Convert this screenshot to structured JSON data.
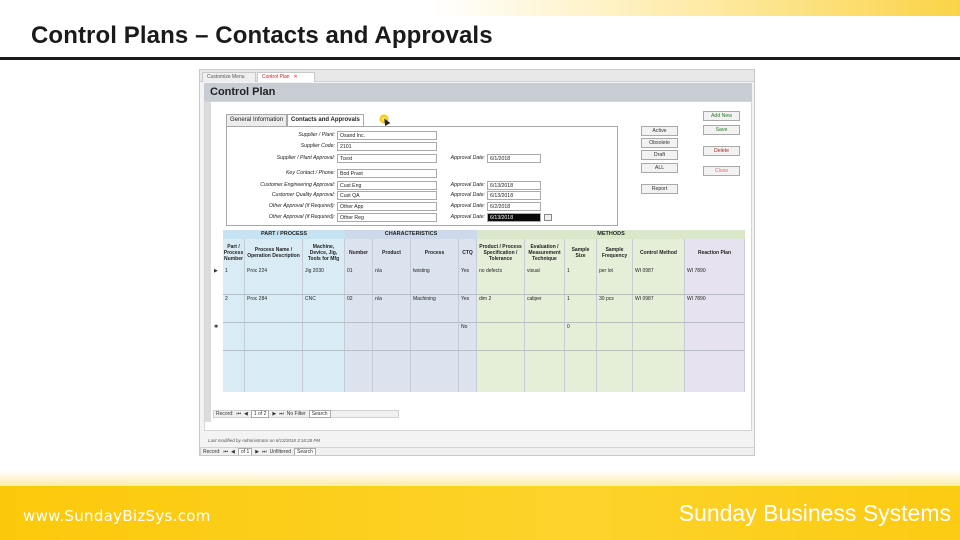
{
  "slide": {
    "title": "Control Plans – Contacts and Approvals",
    "url": "www.SundayBizSys.com",
    "brand": "Sunday Business Systems"
  },
  "app": {
    "doc_tabs": [
      "Customize Menu",
      "Control Plan"
    ],
    "form_title": "Control Plan",
    "form_tabs": [
      "General Information",
      "Contacts and Approvals"
    ],
    "fields": {
      "supplier_plant": {
        "label": "Supplier / Plant:",
        "value": "Osand Inc."
      },
      "supplier_code": {
        "label": "Supplier Code:",
        "value": "2101"
      },
      "supplier_plant_approval": {
        "label": "Supplier / Plant Approval:",
        "value": "Tcest"
      },
      "key_contact_phone": {
        "label": "Key Contact / Phone:",
        "value": "Bod Prast"
      },
      "customer_engineering_approval": {
        "label": "Customer Engineering Approval:",
        "value": "Cust Eng"
      },
      "customer_quality_approval": {
        "label": "Customer Quality Approval:",
        "value": "Cust QA"
      },
      "other_approval_1": {
        "label": "Other Approval (if Required):",
        "value": "Other App"
      },
      "other_approval_2": {
        "label": "Other Approval (if Required):",
        "value": "Other Reg"
      },
      "approval_date_1": {
        "label": "Approval Date:",
        "value": "6/1/2018"
      },
      "approval_date_2": {
        "label": "Approval Date:",
        "value": "6/13/2018"
      },
      "approval_date_3": {
        "label": "Approval Date:",
        "value": "6/13/2018"
      },
      "approval_date_4": {
        "label": "Approval Date:",
        "value": "6/2/2018"
      },
      "approval_date_5": {
        "label": "Approval Date:",
        "value": "6/13/2018"
      }
    },
    "buttons": {
      "add_new": "Add New",
      "save": "Save",
      "active": "Active",
      "obsolete": "Obsolete",
      "draft": "Draft",
      "all": "ALL",
      "delete": "Delete",
      "close": "Close",
      "report": "Report"
    },
    "grid": {
      "groups": [
        "PART / PROCESS",
        "CHARACTERISTICS",
        "METHODS"
      ],
      "columns": [
        "Part / Process Number",
        "Process Name / Operation Description",
        "Machine, Device, Jig, Tools for Mfg",
        "Number",
        "Product",
        "Process",
        "CTQ",
        "Product / Process Specification / Tolerance",
        "Evaluation / Measurement Technique",
        "Sample Size",
        "Sample Frequency",
        "Control Method",
        "Reaction Plan"
      ],
      "rows": [
        [
          "1",
          "Proc 224",
          "Jig 2030",
          "01",
          "n/a",
          "twisting",
          "Yes",
          "no defects",
          "visual",
          "1",
          "per lot",
          "WI 0987",
          "WI 7890"
        ],
        [
          "2",
          "Proc 284",
          "CNC",
          "02",
          "n/a",
          "Machining",
          "Yes",
          "dim 2",
          "caliper",
          "1",
          "30 pcs",
          "WI 0987",
          "WI 7890"
        ],
        [
          "",
          "",
          "",
          "",
          "",
          "",
          "No",
          "",
          "",
          "0",
          "",
          "",
          ""
        ]
      ],
      "subform_nav": {
        "record_label": "Record:",
        "position": "1 of 2",
        "filter": "No Filter",
        "search": "Search"
      }
    },
    "form_nav": {
      "record_label": "Record:",
      "position": "of 1",
      "filter": "Unfiltered",
      "search": "Search"
    },
    "footnote": "Last modified by Administrator on 6/13/2018 3:16:28 PM"
  },
  "colors": {
    "accent_yellow": "#fcc90a",
    "col_part": "#d9ecf6",
    "col_char": "#dbe3ef",
    "col_methods": "#e5efd8",
    "col_reaction": "#e6e2ef"
  }
}
